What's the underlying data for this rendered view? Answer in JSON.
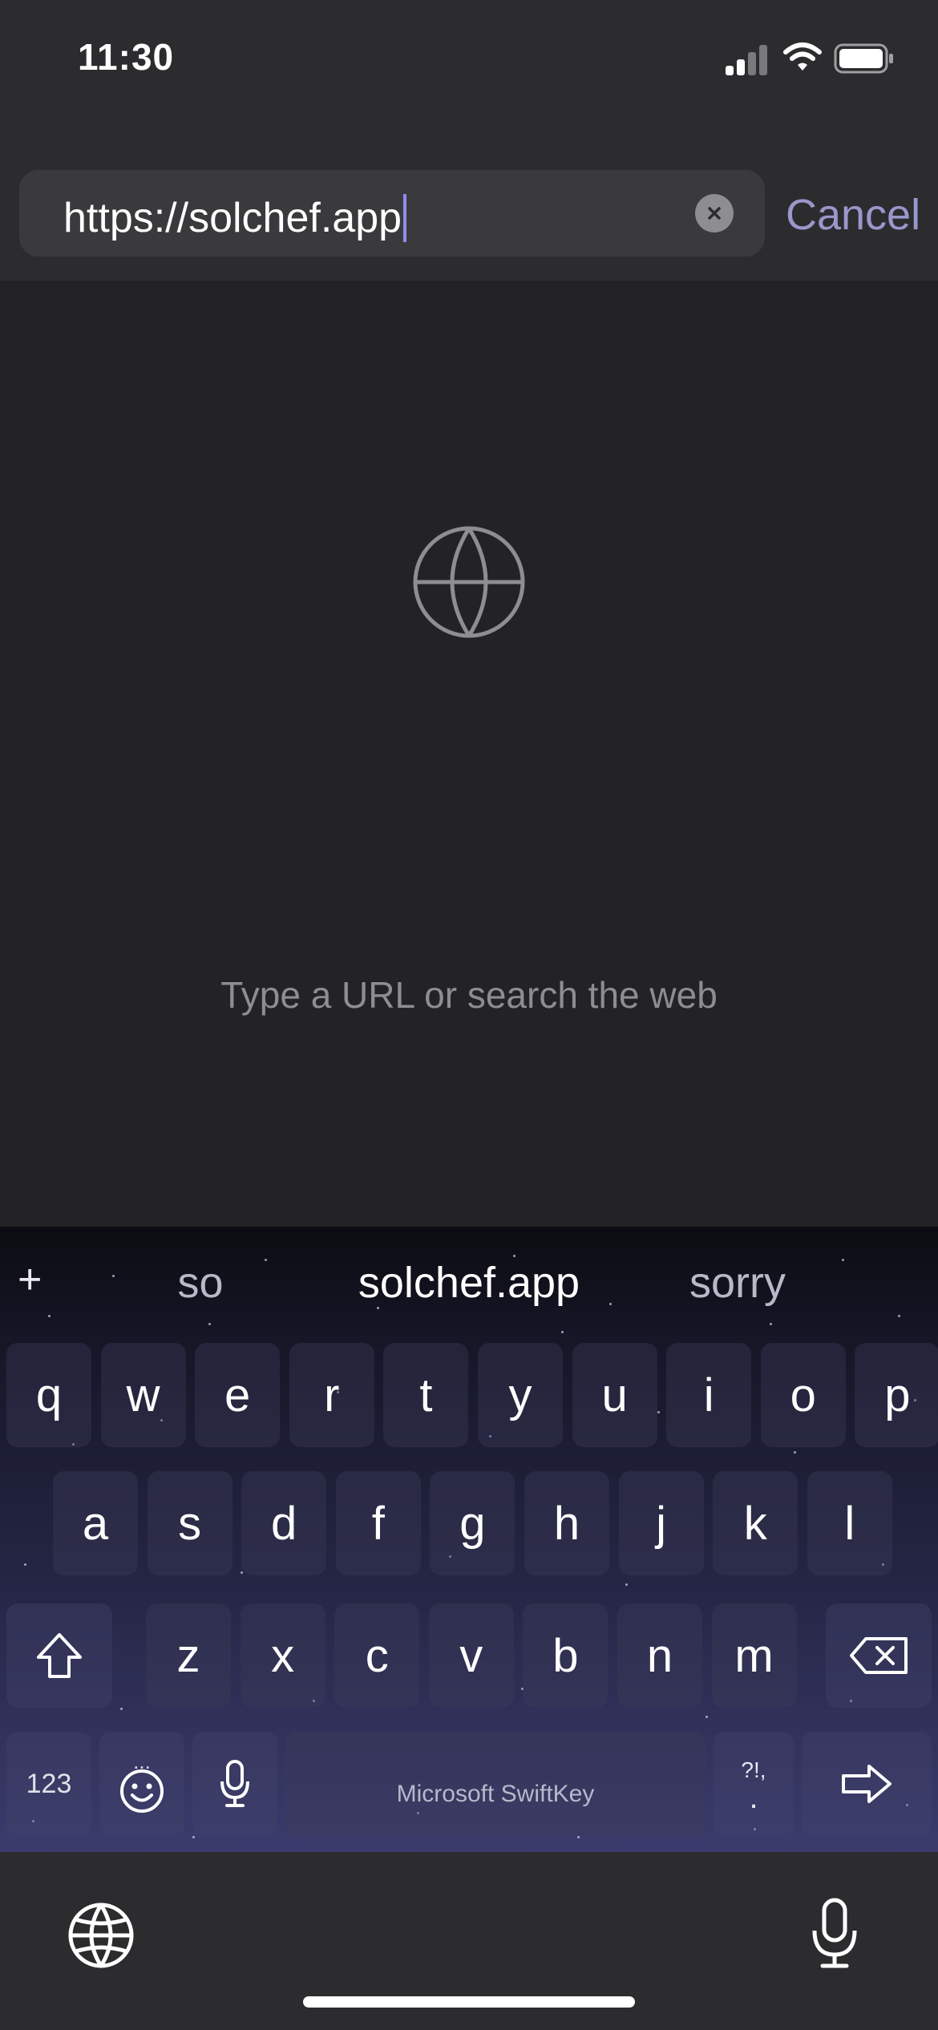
{
  "status_bar": {
    "time": "11:30",
    "signal_icon": "cellular-signal-icon",
    "wifi_icon": "wifi-icon",
    "battery_icon": "battery-icon"
  },
  "url_bar": {
    "value": "https://solchef.app",
    "clear_icon": "clear-x-icon",
    "cancel_label": "Cancel"
  },
  "empty_state": {
    "icon": "globe-icon",
    "message": "Type a URL or search the web"
  },
  "keyboard": {
    "plus_label": "+",
    "suggestions": [
      "so",
      "solchef.app",
      "sorry"
    ],
    "row1": [
      "q",
      "w",
      "e",
      "r",
      "t",
      "y",
      "u",
      "i",
      "o",
      "p"
    ],
    "row2": [
      "a",
      "s",
      "d",
      "f",
      "g",
      "h",
      "j",
      "k",
      "l"
    ],
    "row3": [
      "z",
      "x",
      "c",
      "v",
      "b",
      "n",
      "m"
    ],
    "numbers_label": "123",
    "emoji_dots": "...",
    "space_label": "Microsoft SwiftKey",
    "punct_top": "?!,",
    "punct_bottom": ".",
    "shift_icon": "shift-arrow-icon",
    "backspace_icon": "backspace-icon",
    "emoji_icon": "smiley-icon",
    "mic_icon": "microphone-icon",
    "enter_icon": "go-arrow-icon"
  },
  "bottom_bar": {
    "globe_icon": "globe-icon",
    "mic_icon": "microphone-icon"
  },
  "colors": {
    "accent": "#9a97cc",
    "caret": "#8f8cf0",
    "background": "#232325",
    "bar": "#2c2c2f"
  }
}
